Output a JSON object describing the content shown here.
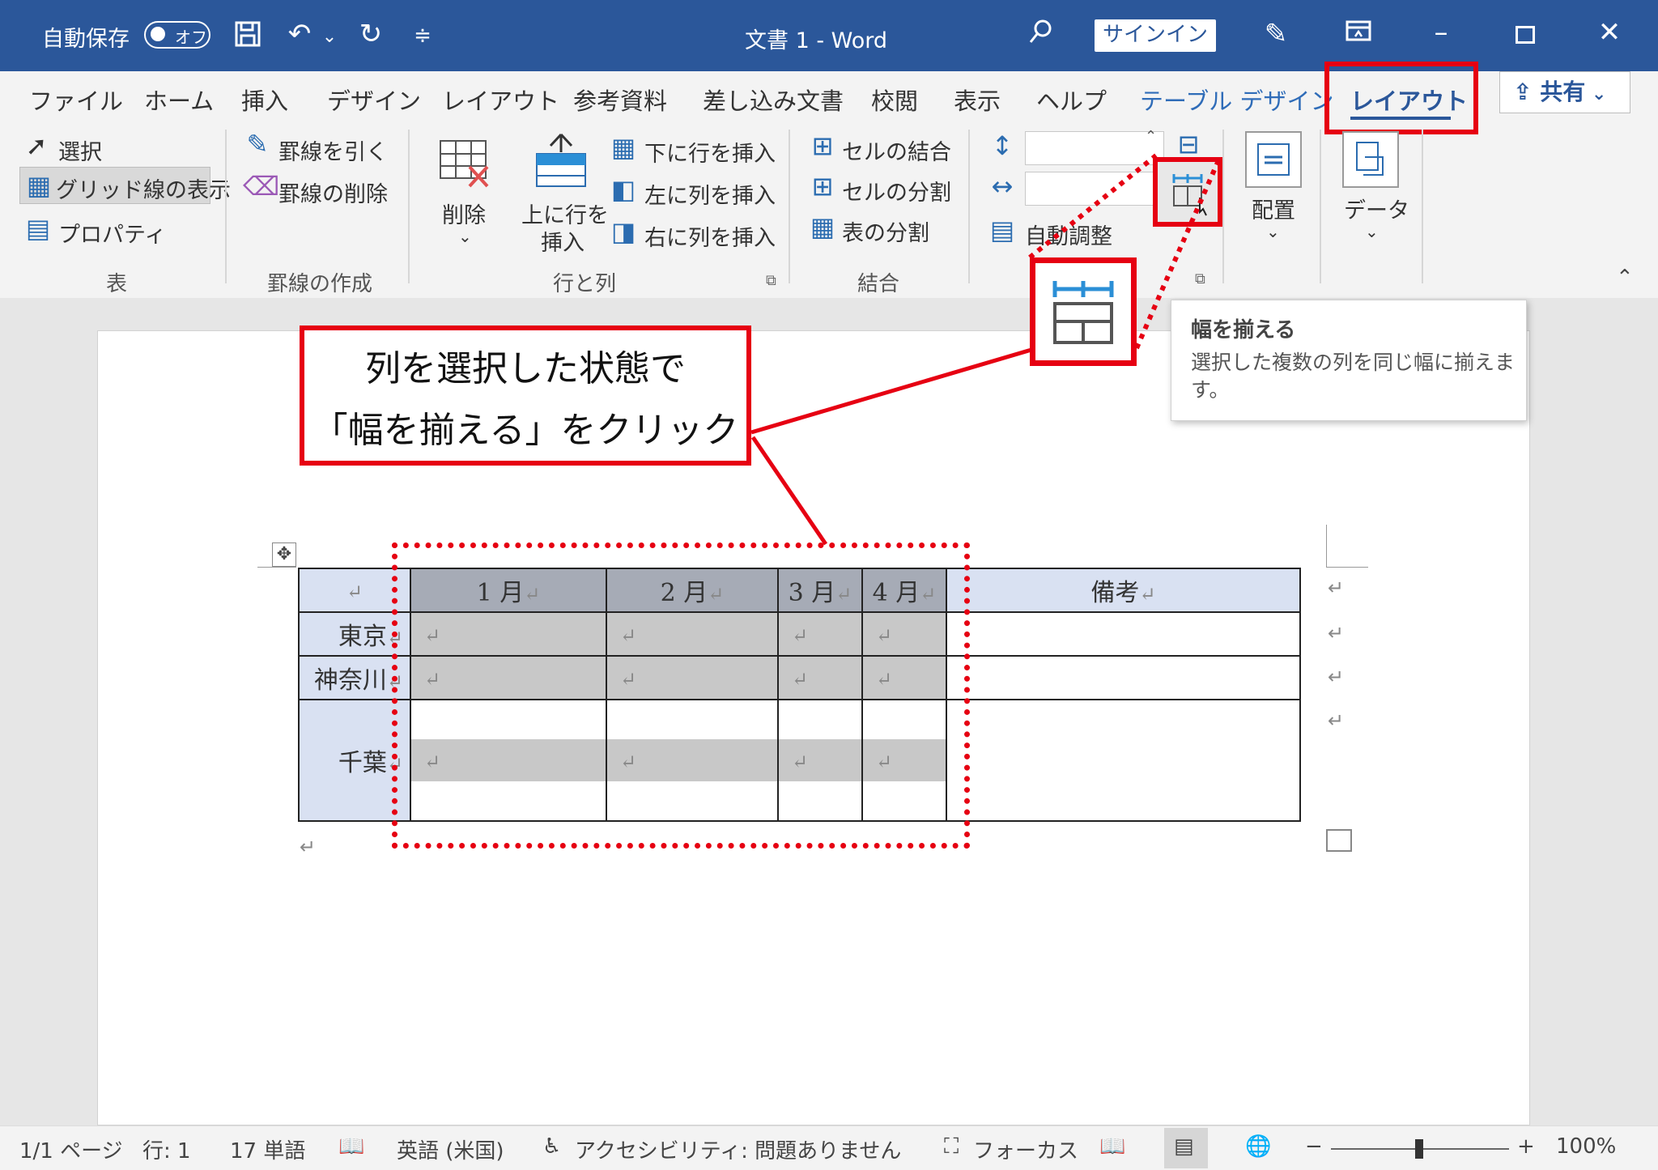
{
  "titlebar": {
    "autosave_label": "自動保存",
    "autosave_state": "オフ",
    "doc_title": "文書 1  -  Word",
    "signin": "サインイン"
  },
  "tabs": [
    "ファイル",
    "ホーム",
    "挿入",
    "デザイン",
    "レイアウト",
    "参考資料",
    "差し込み文書",
    "校閲",
    "表示",
    "ヘルプ",
    "テーブル デザイン",
    "レイアウト"
  ],
  "share_label": "共有",
  "ribbon": {
    "table_group": {
      "select": "選択",
      "gridlines": "グリッド線の表示",
      "properties": "プロパティ",
      "label": "表"
    },
    "draw_group": {
      "draw": "罫線を引く",
      "erase": "罫線の削除",
      "label": "罫線の作成"
    },
    "rows_cols_group": {
      "delete": "削除",
      "insert_above_1": "上に行を",
      "insert_above_2": "挿入",
      "insert_below": "下に行を挿入",
      "insert_left": "左に列を挿入",
      "insert_right": "右に列を挿入",
      "label": "行と列"
    },
    "merge_group": {
      "merge": "セルの結合",
      "split": "セルの分割",
      "split_table": "表の分割",
      "label": "結合"
    },
    "size_group": {
      "autofit": "自動調整"
    },
    "align_group": {
      "label": "配置"
    },
    "data_group": {
      "label": "データ"
    }
  },
  "callout": {
    "line1": "列を選択した状態で",
    "line2": "「幅を揃える」をクリック"
  },
  "tooltip": {
    "title": "幅を揃える",
    "desc_1": "選択した複数の列を同じ幅に揃えま",
    "desc_2": "す。"
  },
  "table": {
    "return_mark": "↵",
    "headers": [
      "1 月",
      "2 月",
      "3 月",
      "4 月",
      "備考"
    ],
    "rows": [
      "東京",
      "神奈川",
      "千葉"
    ]
  },
  "statusbar": {
    "page": "1/1 ページ",
    "line": "行: 1",
    "words": "17 単語",
    "language": "英語 (米国)",
    "accessibility": "アクセシビリティ: 問題ありません",
    "focus": "フォーカス",
    "zoom": "100%"
  },
  "colors": {
    "accent": "#2b579a",
    "highlight_red": "#e60012",
    "selected_col": "#a6abb6",
    "header_fill": "#d9e1f2"
  },
  "icons": [
    "autosave-toggle",
    "save-icon",
    "undo-icon",
    "redo-icon",
    "customize-icon",
    "search-icon",
    "pen-icon",
    "ribbon-display-icon",
    "minimize-icon",
    "maximize-icon",
    "close-icon",
    "distribute-columns-icon"
  ]
}
